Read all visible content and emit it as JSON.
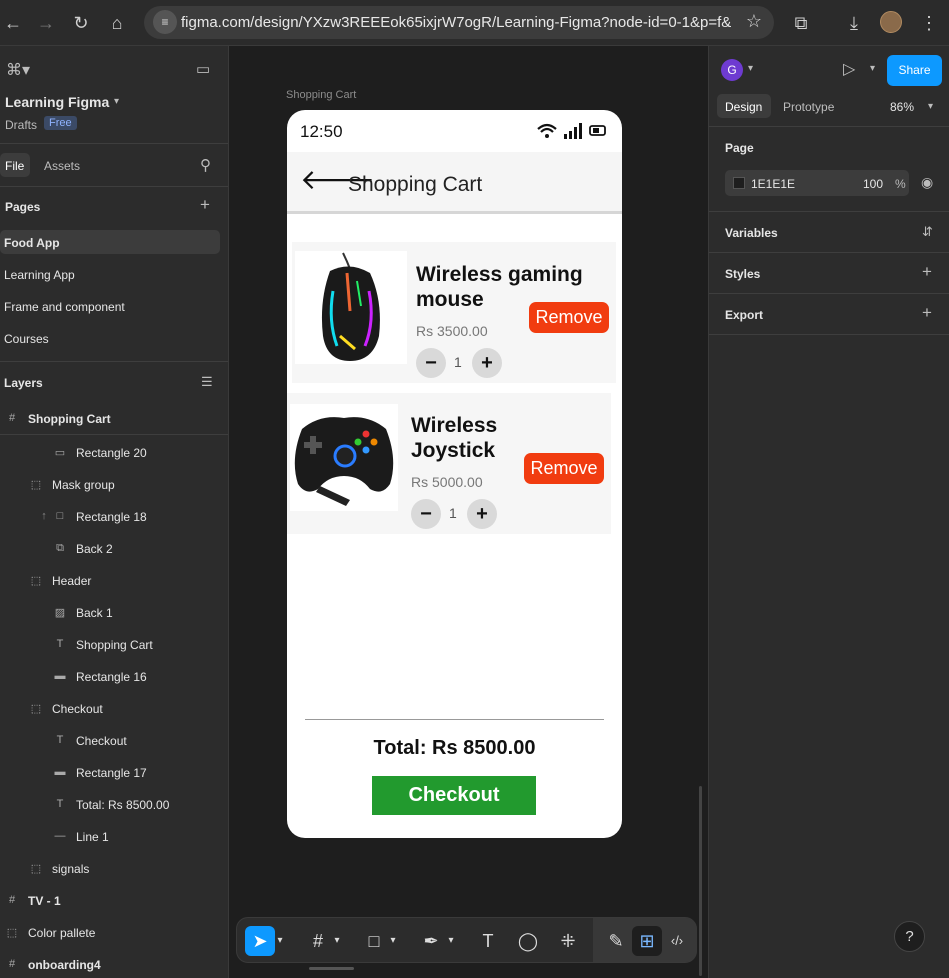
{
  "browser": {
    "url": "figma.com/design/YXzw3REEEok65ixjrW7ogR/Learning-Figma?node-id=0-1&p=f&t=o..."
  },
  "left": {
    "project_name": "Learning Figma",
    "team": "Drafts",
    "plan": "Free",
    "tabs": {
      "file": "File",
      "assets": "Assets"
    },
    "pages_title": "Pages",
    "pages": [
      "Food App",
      "Learning App",
      "Frame and component",
      "Courses"
    ],
    "layers_title": "Layers",
    "layers": [
      {
        "name": "Shopping Cart",
        "icon": "frame-icon"
      },
      {
        "name": "Rectangle 20",
        "icon": "rectangle-icon"
      },
      {
        "name": "Mask group",
        "icon": "group-icon"
      },
      {
        "name": "Rectangle 18",
        "icon": "rectangle-icon"
      },
      {
        "name": "Back 2",
        "icon": "component-icon"
      },
      {
        "name": "Header",
        "icon": "group-icon"
      },
      {
        "name": "Back 1",
        "icon": "image-icon"
      },
      {
        "name": "Shopping Cart",
        "icon": "text-icon"
      },
      {
        "name": "Rectangle 16",
        "icon": "rectangle-icon"
      },
      {
        "name": "Checkout",
        "icon": "group-icon"
      },
      {
        "name": "Checkout",
        "icon": "text-icon"
      },
      {
        "name": "Rectangle 17",
        "icon": "rectangle-icon"
      },
      {
        "name": "Total: Rs 8500.00",
        "icon": "text-icon"
      },
      {
        "name": "Line 1",
        "icon": "line-icon"
      },
      {
        "name": "signals",
        "icon": "group-icon"
      },
      {
        "name": "TV - 1",
        "icon": "frame-icon"
      },
      {
        "name": "Color pallete",
        "icon": "group-icon"
      },
      {
        "name": "onboarding4",
        "icon": "frame-icon"
      }
    ]
  },
  "canvas": {
    "frame_label": "Shopping Cart",
    "phone": {
      "time": "12:50",
      "header_title": "Shopping Cart",
      "items": [
        {
          "name_line1": "Wireless gaming",
          "name_line2": "mouse",
          "price": "Rs 3500.00",
          "qty": "1",
          "remove": "Remove"
        },
        {
          "name_line1": "Wireless",
          "name_line2": "Joystick",
          "price": "Rs 5000.00",
          "qty": "1",
          "remove": "Remove"
        }
      ],
      "minus": "−",
      "plus": "+",
      "total": "Total: Rs 8500.00",
      "checkout": "Checkout"
    }
  },
  "right": {
    "avatar_letter": "G",
    "share": "Share",
    "tabs": {
      "design": "Design",
      "prototype": "Prototype"
    },
    "zoom": "86%",
    "page_title": "Page",
    "bg_color_hex": "1E1E1E",
    "bg_opacity": "100",
    "bg_opacity_unit": "%",
    "sections": [
      "Variables",
      "Styles",
      "Export"
    ]
  },
  "colors": {
    "accent": "#0d99ff",
    "remove": "#f13c10",
    "checkout": "#229a2e"
  }
}
